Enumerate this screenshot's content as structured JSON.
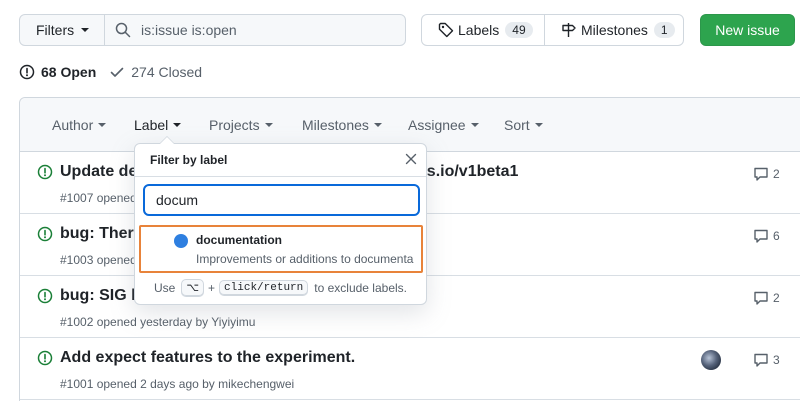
{
  "toolbar": {
    "filters_label": "Filters",
    "search_value": "is:issue is:open",
    "labels_label": "Labels",
    "labels_count": "49",
    "milestones_label": "Milestones",
    "milestones_count": "1",
    "new_issue_label": "New issue",
    "accent_color": "#2da44e"
  },
  "states": {
    "open_label": "68 Open",
    "closed_label": "274 Closed"
  },
  "header": {
    "author": "Author",
    "label": "Label",
    "projects": "Projects",
    "milestones": "Milestones",
    "assignee": "Assignee",
    "sort": "Sort"
  },
  "issues": [
    {
      "title_left": "Update de",
      "title_right": "k8s.io/v1beta1",
      "meta": "#1007 opened",
      "comments": "2"
    },
    {
      "title": "bug: There",
      "meta": "#1003 opened",
      "comments": "6"
    },
    {
      "title": "bug: SIG li",
      "meta": "#1002 opened yesterday by Yiyiyimu",
      "comments": "2"
    },
    {
      "title": "Add expect features to the experiment.",
      "meta": "#1001 opened 2 days ago by mikechengwei",
      "comments": "3"
    }
  ],
  "label_filter": {
    "title": "Filter by label",
    "query": "docum",
    "item_name": "documentation",
    "item_desc": "Improvements or additions to documenta...",
    "item_color": "#0969da",
    "footer_use": "Use",
    "footer_key1": "⌥",
    "footer_plus": "+",
    "footer_key2": "click/return",
    "footer_tail": "to exclude labels."
  }
}
